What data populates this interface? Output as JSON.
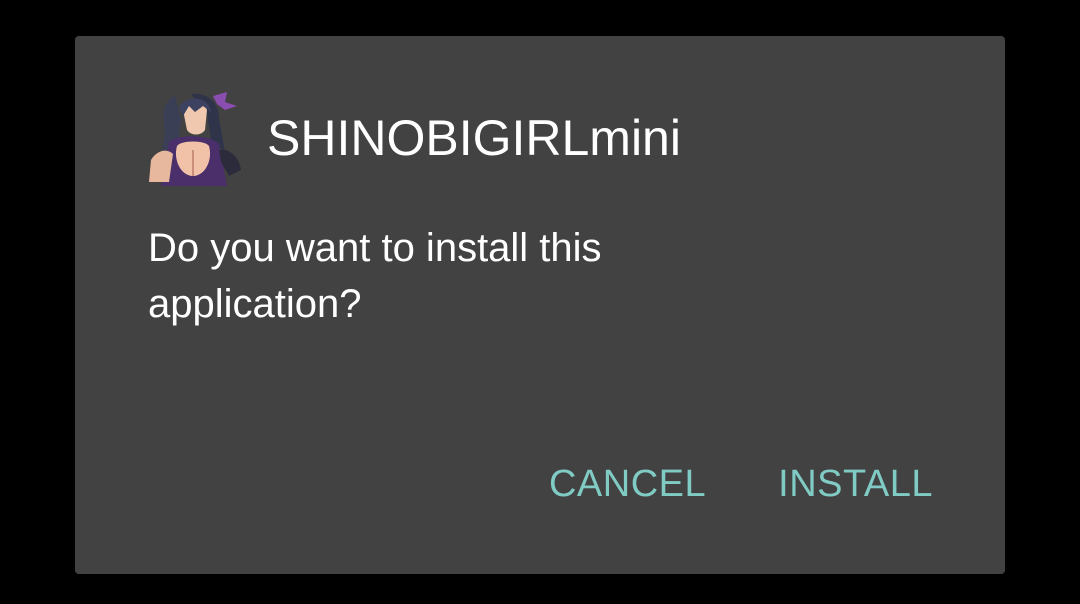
{
  "dialog": {
    "app_icon": "shinobigirl-app-icon",
    "app_name": "SHINOBIGIRLmini",
    "message": "Do you want to install this application?",
    "buttons": {
      "cancel_label": "CANCEL",
      "install_label": "INSTALL"
    }
  },
  "colors": {
    "backdrop": "#000000",
    "dialog_background": "#424242",
    "text": "#ffffff",
    "accent": "#80cbc4"
  }
}
